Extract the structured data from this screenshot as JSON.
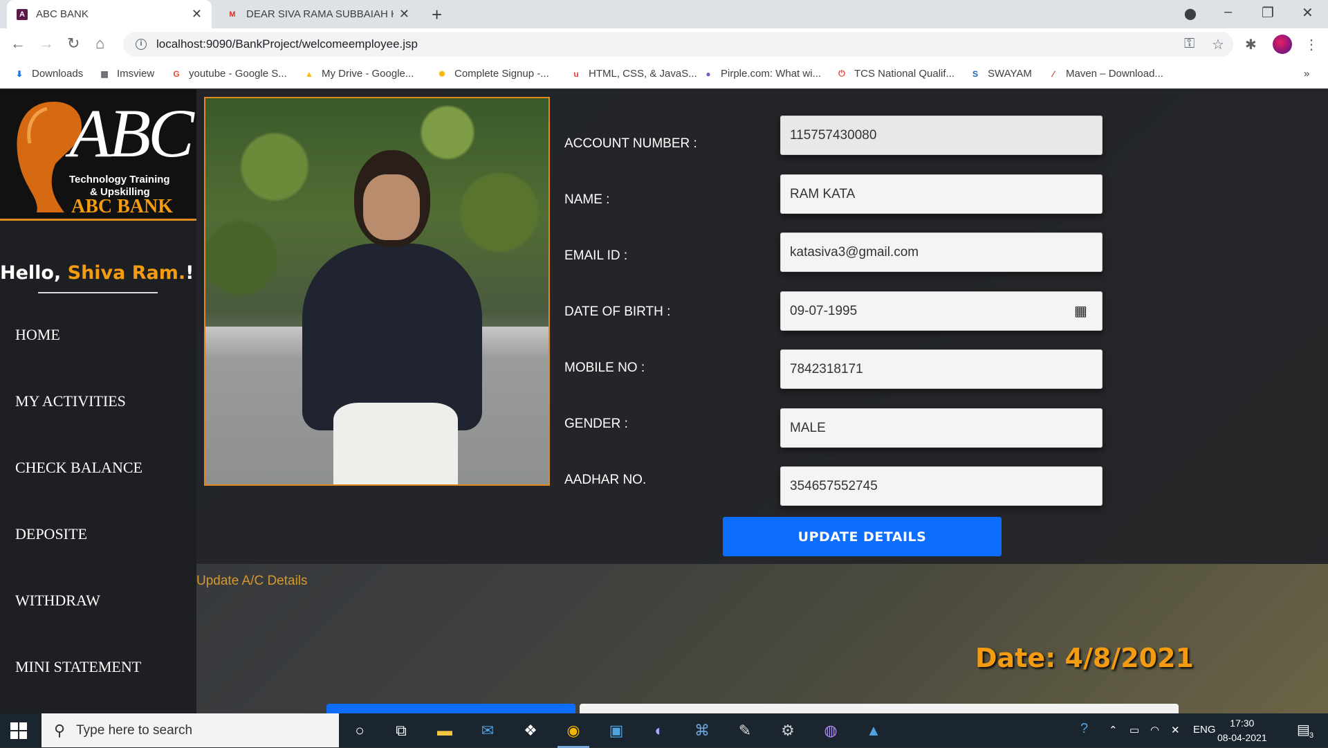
{
  "browser": {
    "tabs": [
      {
        "title": "ABC BANK",
        "favicon": "bank-favicon"
      },
      {
        "title": "DEAR SIVA RAMA SUBBAIAH KAT",
        "favicon": "gmail-icon"
      }
    ],
    "url": "localhost:9090/BankProject/welcomeemployee.jsp",
    "bookmarks": [
      {
        "label": "Downloads",
        "icon": "download-icon"
      },
      {
        "label": "Imsview",
        "icon": "grid-icon"
      },
      {
        "label": "youtube - Google S...",
        "icon": "google-icon"
      },
      {
        "label": "My Drive - Google...",
        "icon": "drive-icon"
      },
      {
        "label": "Complete Signup -...",
        "icon": "sun-icon"
      },
      {
        "label": "HTML, CSS, & JavaS...",
        "icon": "udemy-icon"
      },
      {
        "label": "Pirple.com: What wi...",
        "icon": "pirple-icon"
      },
      {
        "label": "TCS National Qualif...",
        "icon": "tcs-icon"
      },
      {
        "label": "SWAYAM",
        "icon": "swayam-icon"
      },
      {
        "label": "Maven – Download...",
        "icon": "maven-icon"
      }
    ],
    "bookmarks_more": "»"
  },
  "logo": {
    "abc": "ABC",
    "line1": "Technology Training",
    "line2": "& Upskilling",
    "bank_name": "ABC BANK"
  },
  "sidebar": {
    "greeting_prefix": "Hello, ",
    "user_name": "Shiva Ram.",
    "greeting_suffix": "!",
    "nav": [
      "HOME",
      "MY ACTIVITIES",
      "CHECK BALANCE",
      "DEPOSITE",
      "WITHDRAW",
      "MINI STATEMENT"
    ]
  },
  "form": {
    "fields": [
      {
        "label": "ACCOUNT NUMBER :",
        "value": "115757430080"
      },
      {
        "label": "NAME :",
        "value": "RAM KATA"
      },
      {
        "label": "EMAIL ID :",
        "value": "katasiva3@gmail.com"
      },
      {
        "label": "DATE OF BIRTH :",
        "value": "09-07-1995"
      },
      {
        "label": "MOBILE NO :",
        "value": "7842318171"
      },
      {
        "label": "GENDER :",
        "value": "MALE"
      },
      {
        "label": "AADHAR NO.",
        "value": "354657552745"
      }
    ],
    "update_button": "UPDATE DETAILS"
  },
  "update_link": "Update A/C Details",
  "date_display": "Date: 4/8/2021",
  "taskbar": {
    "search_placeholder": "Type here to search",
    "language": "ENG",
    "time": "17:30",
    "date": "08-04-2021",
    "notification_count": "3"
  },
  "colors": {
    "accent_orange": "#f39c12",
    "button_blue": "#0d6efd",
    "sidebar_bg": "#1d1f22"
  }
}
